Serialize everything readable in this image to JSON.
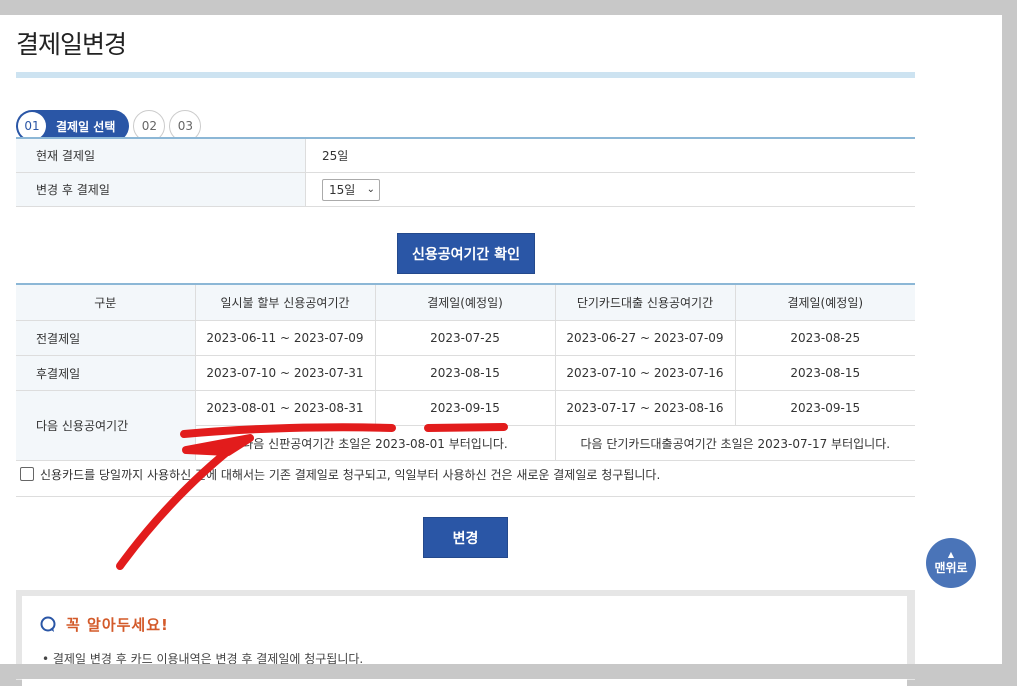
{
  "title": "결제일변경",
  "steps": {
    "active_num": "01",
    "active_label": "결제일 선택",
    "step2": "02",
    "step3": "03"
  },
  "form": {
    "current_label": "현재 결제일",
    "current_value": "25일",
    "after_label": "변경 후 결제일",
    "after_value": "15일"
  },
  "check_button": "신용공여기간 확인",
  "table": {
    "headers": [
      "구분",
      "일시불 할부 신용공여기간",
      "결제일(예정일)",
      "단기카드대출 신용공여기간",
      "결제일(예정일)"
    ],
    "rows": [
      {
        "label": "전결제일",
        "cells": [
          "2023-06-11 ~ 2023-07-09",
          "2023-07-25",
          "2023-06-27 ~ 2023-07-09",
          "2023-08-25"
        ]
      },
      {
        "label": "후결제일",
        "cells": [
          "2023-07-10 ~ 2023-07-31",
          "2023-08-15",
          "2023-07-10 ~ 2023-07-16",
          "2023-08-15"
        ]
      },
      {
        "label": "다음 신용공여기간",
        "cells": [
          "2023-08-01 ~ 2023-08-31",
          "2023-09-15",
          "2023-07-17 ~ 2023-08-16",
          "2023-09-15"
        ]
      }
    ],
    "note_left": "다음 신판공여기간 초일은 2023-08-01 부터입니다.",
    "note_right": "다음 단기카드대출공여기간 초일은 2023-07-17 부터입니다."
  },
  "agree_text": "신용카드를 당일까지 사용하신 건에 대해서는 기존 결제일로 청구되고, 익일부터 사용하신 건은 새로운 결제일로 청구됩니다.",
  "change_button": "변경",
  "info": {
    "heading": "꼭 알아두세요!",
    "text": "• 결제일 변경 후 카드 이용내역은 변경 후 결제일에 청구됩니다."
  },
  "top_button": "맨위로",
  "colors": {
    "primary": "#2a56a6",
    "accent": "#d35a2a",
    "ink": "#e21c1c"
  }
}
